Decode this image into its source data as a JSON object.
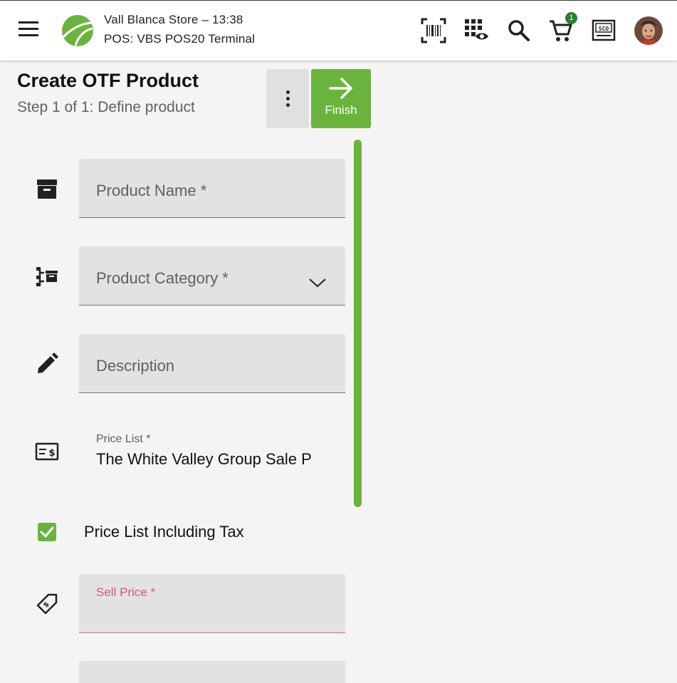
{
  "header": {
    "store_title": "Vall Blanca Store – 13:38",
    "pos_terminal": "POS: VBS POS20 Terminal",
    "cart_count": "1",
    "icons": [
      "menu-icon",
      "store-logo",
      "barcode-scan-icon",
      "keypad-visibility-icon",
      "search-icon",
      "cart-icon",
      "self-checkout-icon",
      "user-avatar"
    ]
  },
  "page": {
    "title": "Create OTF Product",
    "subtitle": "Step 1 of 1: Define product",
    "finish_label": "Finish"
  },
  "form": {
    "product_name_placeholder": "Product Name *",
    "product_category_placeholder": "Product Category *",
    "description_placeholder": "Description",
    "price_list_label": "Price List *",
    "price_list_value": "The White Valley Group Sale P",
    "price_includes_tax_label": "Price List Including Tax",
    "price_includes_tax_checked": true,
    "sell_price_label": "Sell Price",
    "sell_price_required": "*"
  },
  "colors": {
    "accent": "#6ab43e",
    "badge": "#2e7d32",
    "error": "#d45b73",
    "field_bg": "#e2e2e2"
  }
}
